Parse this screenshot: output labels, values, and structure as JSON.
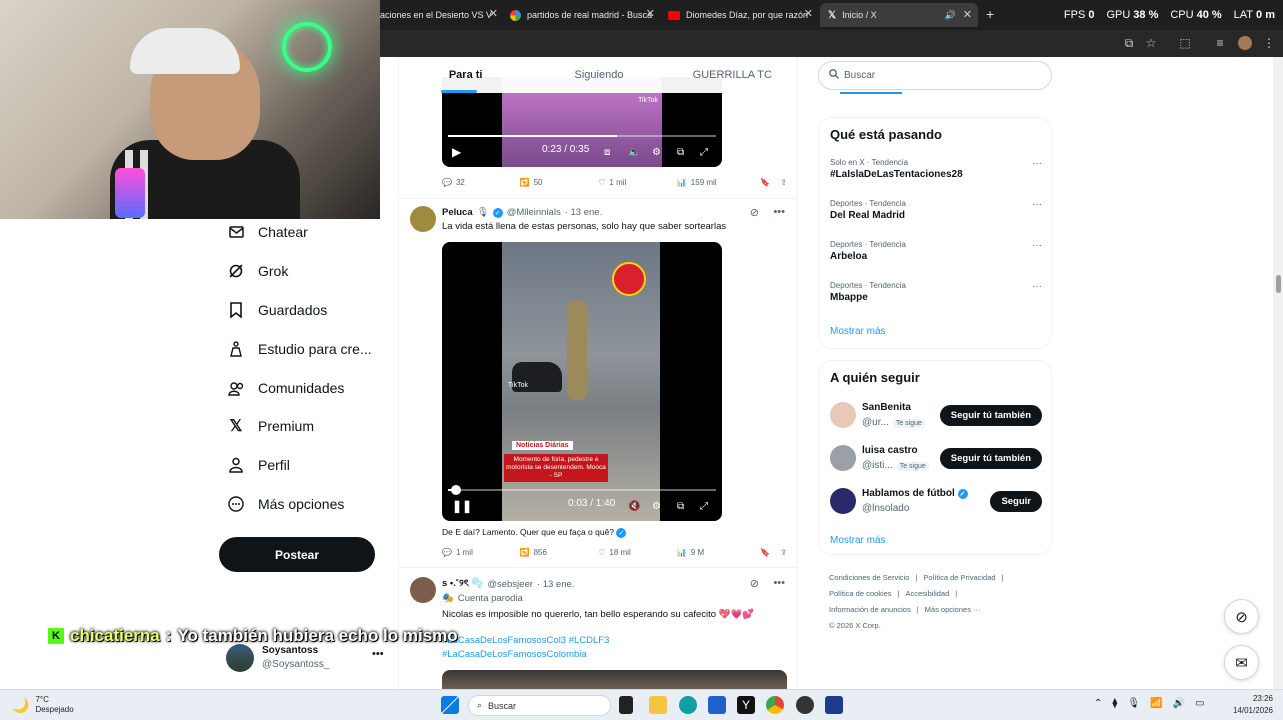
{
  "browser": {
    "tabs": [
      {
        "title": "aciones en el Desierto VS V"
      },
      {
        "title": "partidos de real madrid - Busca"
      },
      {
        "title": "Diomedes Díaz, por que razón"
      },
      {
        "title": "Inicio / X"
      }
    ],
    "new_tab": "+",
    "stats": {
      "fps_label": "FPS",
      "fps": "0",
      "gpu_label": "GPU",
      "gpu": "38 %",
      "cpu_label": "CPU",
      "cpu": "40 %",
      "lat_label": "LAT",
      "lat": "0 m"
    }
  },
  "nav": {
    "items": [
      {
        "label": "Chatear",
        "icon": "mail-icon"
      },
      {
        "label": "Grok",
        "icon": "grok-icon"
      },
      {
        "label": "Guardados",
        "icon": "bookmark-icon"
      },
      {
        "label": "Estudio para cre...",
        "icon": "studio-icon"
      },
      {
        "label": "Comunidades",
        "icon": "communities-icon"
      },
      {
        "label": "Premium",
        "icon": "x-icon"
      },
      {
        "label": "Perfil",
        "icon": "person-icon"
      },
      {
        "label": "Más opciones",
        "icon": "more-icon"
      }
    ],
    "post_label": "Postear",
    "account": {
      "name": "Soysantoss",
      "handle": "@Soysantoss_"
    }
  },
  "chat": {
    "badge": "K",
    "user": "chicatierna",
    "separator": ":",
    "message": "Yo también hubiera echo lo mismo"
  },
  "feed": {
    "tabs": [
      "Para ti",
      "Siguiendo",
      "GUERRILLA TC"
    ],
    "tweet1": {
      "video_time": "0:23 / 0:35",
      "video_progress": 0.63,
      "tiktok_label": "TikTok",
      "replies": "32",
      "retweets": "50",
      "likes": "1 mil",
      "views": "159 mil"
    },
    "tweet2": {
      "name": "Peluca",
      "handle": "@Mlleinnials",
      "date": "· 13 ene.",
      "text": "La vida está llena de estas personas, solo hay que saber sortearlas",
      "video_time": "0:03 / 1:40",
      "video_progress": 0.03,
      "tiktok_label": "TikTok",
      "overlay_title": "Notícias Diárias",
      "overlay_caption": "Momento de fúria, pedestre e motorista se desentendem. Mooca - SP",
      "caption_prefix": "De",
      "caption_link": "E daí? Lamento. Quer que eu faça o quê?",
      "replies": "1 mil",
      "retweets": "856",
      "likes": "18 mil",
      "views": "9 M"
    },
    "tweet3": {
      "name": "s •.˚୨ৎ 🫧",
      "handle": "@sebsjeer",
      "date": "· 13 ene.",
      "label": "Cuenta parodia",
      "text": "Nicolas es imposible no quererlo, tan bello esperando su cafecito 💖💗💕",
      "hashtags1": "#LaCasaDeLosFamososCol3 #LCDLF3",
      "hashtags2": "#LaCasaDeLosFamososColombia"
    }
  },
  "right": {
    "search_placeholder": "Buscar",
    "trends_title": "Qué está pasando",
    "trends": [
      {
        "meta": "Solo en X · Tendencia",
        "name": "#LaIslaDeLasTentaciones28"
      },
      {
        "meta": "Deportes · Tendencia",
        "name": "Del Real Madrid"
      },
      {
        "meta": "Deportes · Tendencia",
        "name": "Arbeloa"
      },
      {
        "meta": "Deportes · Tendencia",
        "name": "Mbappe"
      }
    ],
    "show_more": "Mostrar más",
    "who_title": "A quién seguir",
    "who": [
      {
        "name": "SanBenita",
        "handle": "@ur...",
        "badge": "Te sigue",
        "button": "Seguir tú también"
      },
      {
        "name": "luisa castro",
        "handle": "@isti...",
        "badge": "Te sigue",
        "button": "Seguir tú también"
      },
      {
        "name": "Hablamos de fútbol",
        "handle": "@lnsolado",
        "badge": "",
        "button": "Seguir"
      }
    ],
    "footer": [
      "Condiciones de Servicio",
      "|",
      "Política de Privacidad",
      "|",
      "Política de cookies",
      "|",
      "Accesibilidad",
      "|",
      "Información de anuncios",
      "|",
      "Más opciones ···",
      "© 2026 X Corp."
    ]
  },
  "taskbar": {
    "weather_temp": "7°C",
    "weather_desc": "Despejado",
    "search_placeholder": "Buscar",
    "time": "23:26",
    "date": "14/01/2026"
  },
  "colors": {
    "accent": "#1d9bf0",
    "dark": "#0f1419",
    "muted": "#536471",
    "kick": "#53fc18"
  }
}
